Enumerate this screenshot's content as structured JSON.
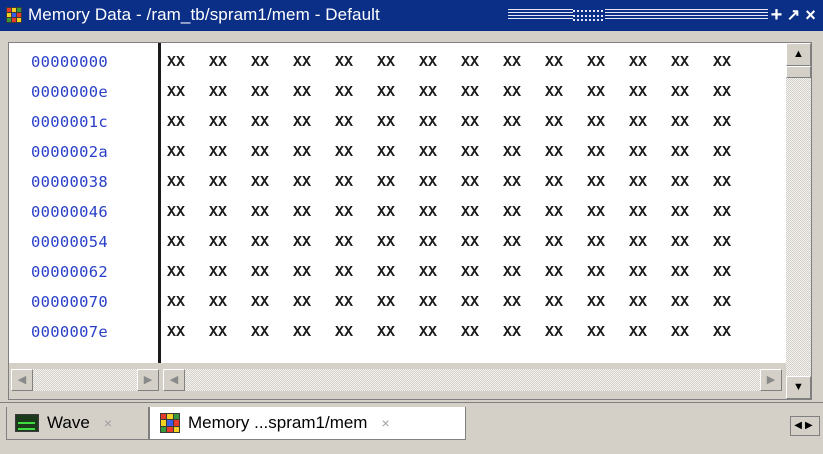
{
  "window": {
    "title": "Memory Data - /ram_tb/spram1/mem - Default",
    "icon": "memory-grid-icon",
    "buttons": {
      "plus": "+",
      "undock": "↗",
      "close": "×"
    }
  },
  "memory": {
    "addresses": [
      "00000000",
      "0000000e",
      "0000001c",
      "0000002a",
      "00000038",
      "00000046",
      "00000054",
      "00000062",
      "00000070",
      "0000007e"
    ],
    "rows": [
      [
        "XX",
        "XX",
        "XX",
        "XX",
        "XX",
        "XX",
        "XX",
        "XX",
        "XX",
        "XX",
        "XX",
        "XX",
        "XX",
        "XX"
      ],
      [
        "XX",
        "XX",
        "XX",
        "XX",
        "XX",
        "XX",
        "XX",
        "XX",
        "XX",
        "XX",
        "XX",
        "XX",
        "XX",
        "XX"
      ],
      [
        "XX",
        "XX",
        "XX",
        "XX",
        "XX",
        "XX",
        "XX",
        "XX",
        "XX",
        "XX",
        "XX",
        "XX",
        "XX",
        "XX"
      ],
      [
        "XX",
        "XX",
        "XX",
        "XX",
        "XX",
        "XX",
        "XX",
        "XX",
        "XX",
        "XX",
        "XX",
        "XX",
        "XX",
        "XX"
      ],
      [
        "XX",
        "XX",
        "XX",
        "XX",
        "XX",
        "XX",
        "XX",
        "XX",
        "XX",
        "XX",
        "XX",
        "XX",
        "XX",
        "XX"
      ],
      [
        "XX",
        "XX",
        "XX",
        "XX",
        "XX",
        "XX",
        "XX",
        "XX",
        "XX",
        "XX",
        "XX",
        "XX",
        "XX",
        "XX"
      ],
      [
        "XX",
        "XX",
        "XX",
        "XX",
        "XX",
        "XX",
        "XX",
        "XX",
        "XX",
        "XX",
        "XX",
        "XX",
        "XX",
        "XX"
      ],
      [
        "XX",
        "XX",
        "XX",
        "XX",
        "XX",
        "XX",
        "XX",
        "XX",
        "XX",
        "XX",
        "XX",
        "XX",
        "XX",
        "XX"
      ],
      [
        "XX",
        "XX",
        "XX",
        "XX",
        "XX",
        "XX",
        "XX",
        "XX",
        "XX",
        "XX",
        "XX",
        "XX",
        "XX",
        "XX"
      ],
      [
        "XX",
        "XX",
        "XX",
        "XX",
        "XX",
        "XX",
        "XX",
        "XX",
        "XX",
        "XX",
        "XX",
        "XX",
        "XX",
        "XX"
      ]
    ]
  },
  "tabs": [
    {
      "label": "Wave",
      "icon": "wave-icon",
      "close": "×",
      "active": false
    },
    {
      "label": "Memory ...spram1/mem",
      "icon": "memory-grid-icon",
      "close": "×",
      "active": true
    }
  ],
  "colors": {
    "titlebar": "#0b2f87",
    "address_text": "#2a40c8",
    "data_text": "#1a1a1a",
    "chrome": "#d4d0c8"
  }
}
